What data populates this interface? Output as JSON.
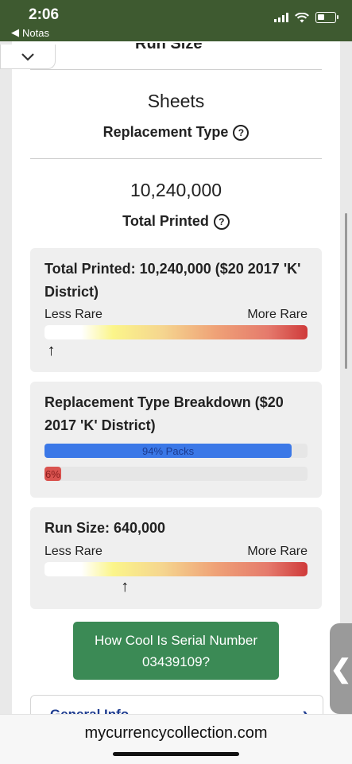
{
  "status_bar": {
    "time": "2:06",
    "back_app": "Notas"
  },
  "top": {
    "partial_heading": "Run Size"
  },
  "replacement_type": {
    "value": "Sheets",
    "label": "Replacement Type"
  },
  "total_printed": {
    "value": "10,240,000",
    "label": "Total Printed"
  },
  "total_printed_panel": {
    "title": "Total Printed: 10,240,000 ($20 2017 'K' District)",
    "less_rare": "Less Rare",
    "more_rare": "More Rare",
    "marker_position_pct": 0.02
  },
  "breakdown_panel": {
    "title": "Replacement Type Breakdown ($20 2017 'K' District)",
    "bars": [
      {
        "label": "94% Packs",
        "percent": 94,
        "color": "#3b78e7"
      },
      {
        "label": "6%",
        "percent": 6,
        "color": "#d9534f"
      }
    ]
  },
  "run_size_panel": {
    "title": "Run Size: 640,000",
    "less_rare": "Less Rare",
    "more_rare": "More Rare",
    "marker_position_pct": 0.3
  },
  "cta": {
    "label": "How Cool Is Serial Number 03439109?"
  },
  "general_info": {
    "label": "General Info"
  },
  "browser": {
    "url": "mycurrencycollection.com"
  }
}
